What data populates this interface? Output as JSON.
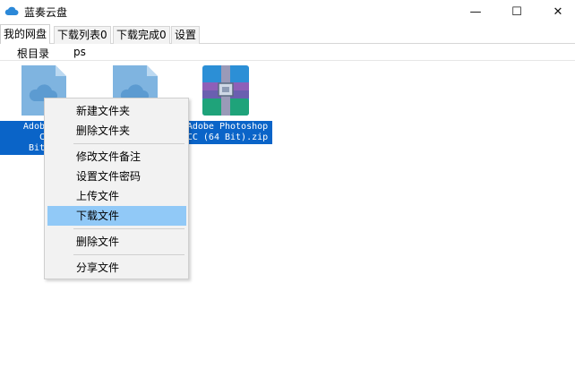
{
  "window": {
    "title": "蓝奏云盘",
    "minimize_glyph": "—",
    "maximize_glyph": "☐",
    "close_glyph": "✕"
  },
  "tabs": [
    {
      "label": "我的网盘",
      "active": true
    },
    {
      "label": "下载列表0",
      "active": false
    },
    {
      "label": "下载完成0",
      "active": false
    },
    {
      "label": "设置",
      "active": false
    }
  ],
  "path": {
    "root": "根目录",
    "current": "ps"
  },
  "files": [
    {
      "name": "Adobe Photoshop CC (64 Bit).zip",
      "icon": "cloud-file-icon",
      "visible_name": "Adobe Ph\nCC\nBit).z"
    },
    {
      "name": "",
      "icon": "cloud-file-icon"
    },
    {
      "name": "Adobe Photoshop CC (64 Bit).zip",
      "icon": "archive-icon"
    }
  ],
  "context_menu": {
    "items": [
      {
        "label": "新建文件夹"
      },
      {
        "label": "删除文件夹"
      },
      {
        "label": "修改文件备注"
      },
      {
        "label": "设置文件密码"
      },
      {
        "label": "上传文件"
      },
      {
        "label": "下载文件",
        "highlighted": true
      },
      {
        "label": "删除文件"
      },
      {
        "label": "分享文件"
      }
    ]
  },
  "colors": {
    "selection": "#0a64c8",
    "menu_highlight": "#91c9f7",
    "cloud_icon": "#7fb4e0"
  }
}
